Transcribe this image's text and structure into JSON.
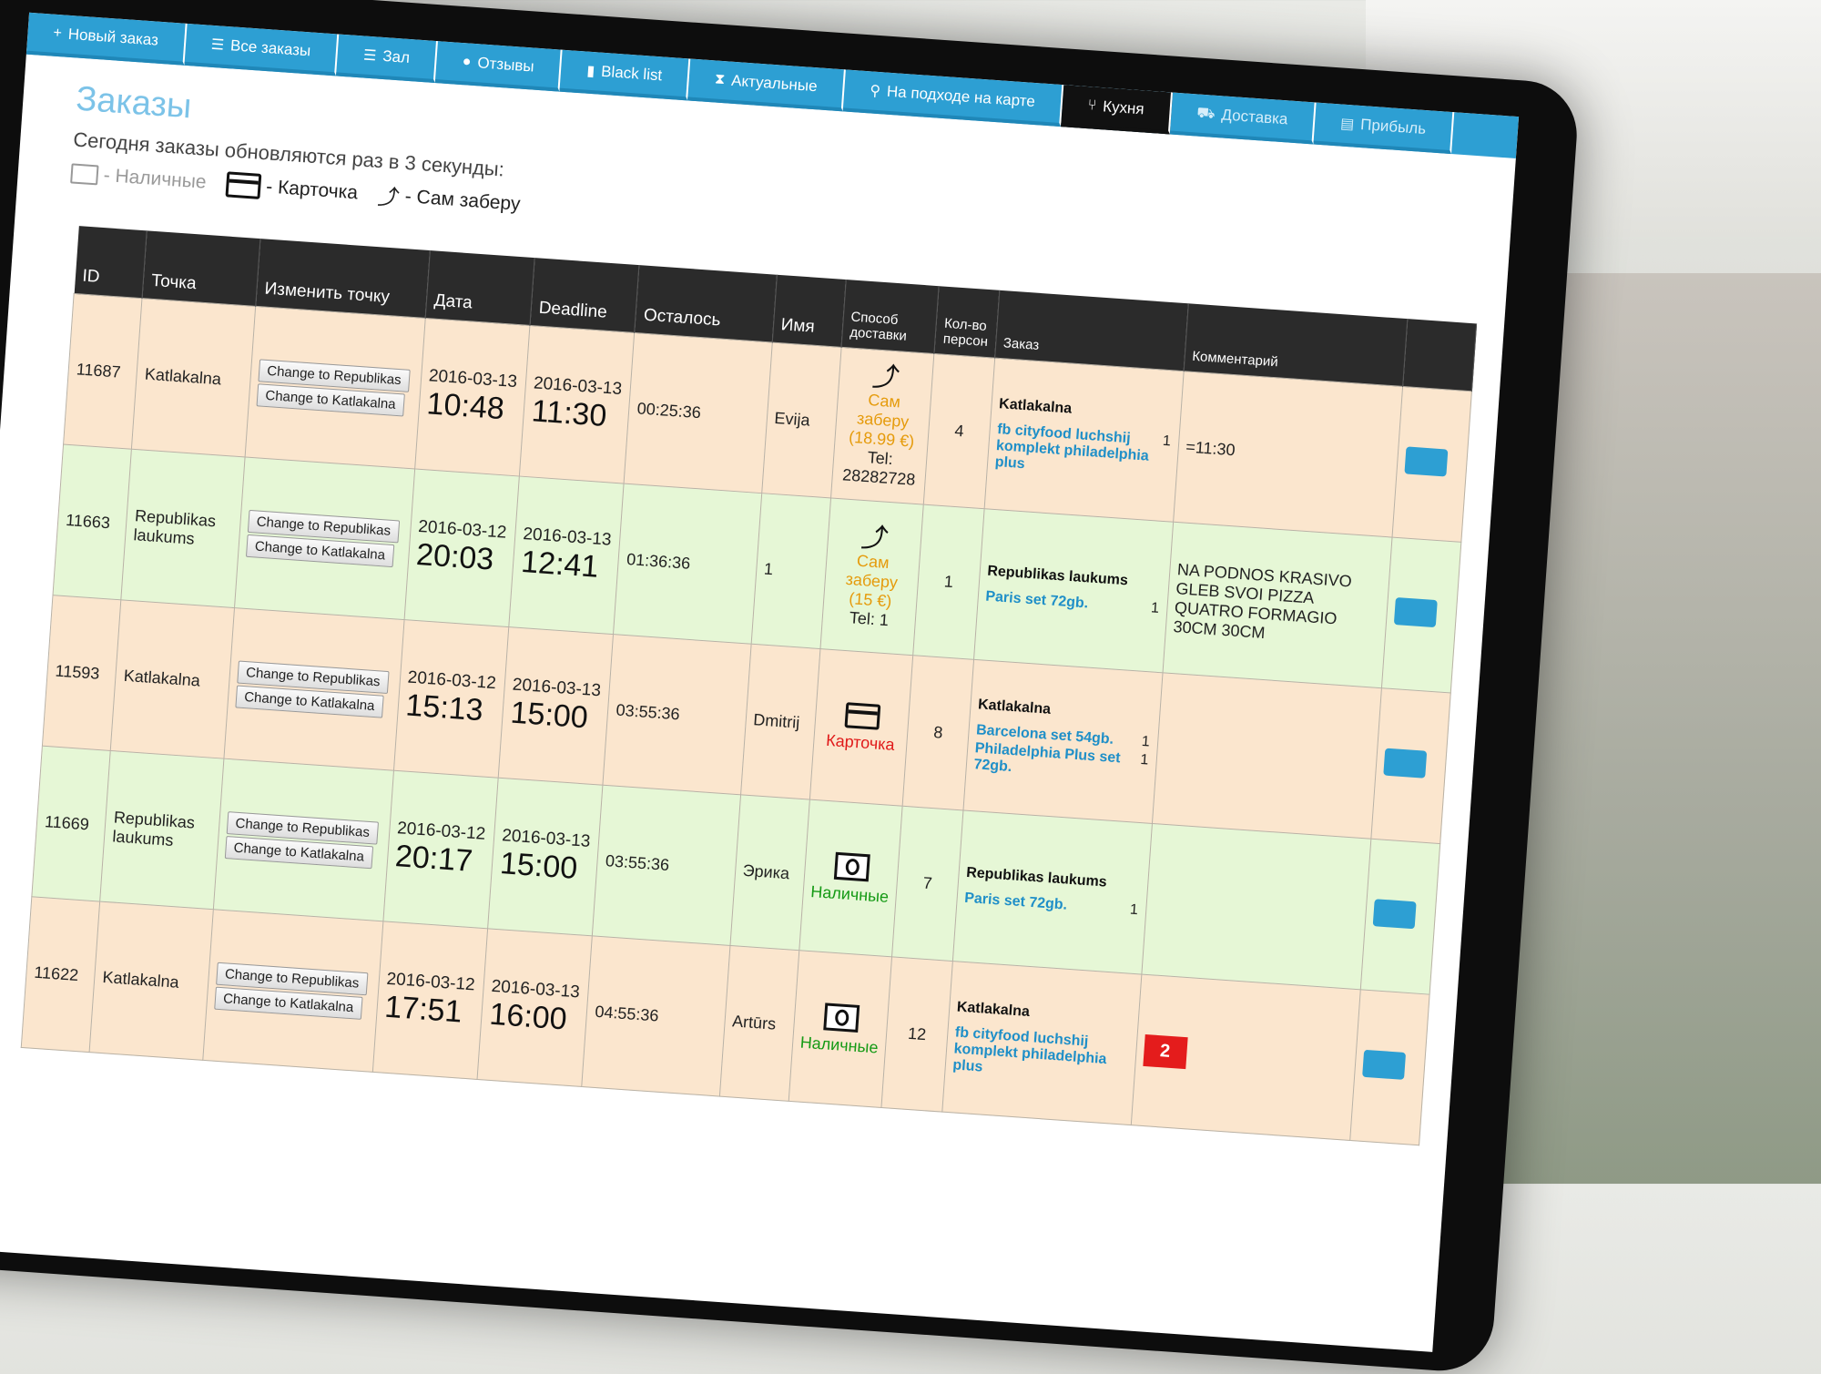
{
  "nav": {
    "tabs": [
      {
        "icon": "+",
        "label": "Новый заказ"
      },
      {
        "icon": "☰",
        "label": "Все заказы"
      },
      {
        "icon": "☰",
        "label": "Зал"
      },
      {
        "icon": "●",
        "label": "Отзывы"
      },
      {
        "icon": "▮",
        "label": "Black list"
      },
      {
        "icon": "⧗",
        "label": "Актуальные"
      },
      {
        "icon": "⚲",
        "label": "На подходе на карте"
      },
      {
        "icon": "⑂",
        "label": "Кухня"
      },
      {
        "icon": "⛟",
        "label": "Доставка"
      },
      {
        "icon": "▤",
        "label": "Прибыль"
      }
    ],
    "active_index": 7
  },
  "page": {
    "title": "Заказы",
    "info": "Сегодня заказы обновляются раз в 3 секунды:",
    "legend": {
      "cash": "- Наличные",
      "card": "- Карточка",
      "pickup": "- Сам заберу"
    }
  },
  "table": {
    "headers": {
      "id": "ID",
      "point": "Точка",
      "change": "Изменить точку",
      "date": "Дата",
      "deadline": "Deadline",
      "left": "Осталось",
      "name": "Имя",
      "delivery": "Способ доставки",
      "persons": "Кол-во персон",
      "order": "Заказ",
      "comment": "Комментарий"
    },
    "change_to_republikas": "Change to Republikas",
    "change_to_katlakalna": "Change to Katlakalna",
    "rows": [
      {
        "id": "11687",
        "point": "Katlakalna",
        "color": "orange",
        "date": "2016-03-13",
        "date_time": "10:48",
        "deadline": "2016-03-13",
        "deadline_time": "11:30",
        "left": "00:25:36",
        "name": "Evija",
        "delivery": {
          "icon": "pickup-icon",
          "label": "Сам заберу",
          "price": "(18.99 €)",
          "tel": "Tel: 28282728"
        },
        "persons": "4",
        "order_loc": "Katlakalna",
        "items": [
          {
            "name": "fb cityfood luchshij komplekt philadelphia plus",
            "qty": "1"
          }
        ],
        "comment": "=11:30",
        "badge": ""
      },
      {
        "id": "11663",
        "point": "Republikas laukums",
        "color": "green",
        "date": "2016-03-12",
        "date_time": "20:03",
        "deadline": "2016-03-13",
        "deadline_time": "12:41",
        "left": "01:36:36",
        "name": "1",
        "delivery": {
          "icon": "pickup-icon",
          "label": "Сам заберу",
          "price": "(15 €)",
          "tel": "Tel: 1"
        },
        "persons": "1",
        "order_loc": "Republikas laukums",
        "items": [
          {
            "name": "Paris set 72gb.",
            "qty": "1"
          }
        ],
        "comment": "NA PODNOS KRASIVO GLEB SVOI PIZZA QUATRO FORMAGIO 30CM 30CM",
        "badge": ""
      },
      {
        "id": "11593",
        "point": "Katlakalna",
        "color": "orange",
        "date": "2016-03-12",
        "date_time": "15:13",
        "deadline": "2016-03-13",
        "deadline_time": "15:00",
        "left": "03:55:36",
        "name": "Dmitrij",
        "delivery": {
          "icon": "card-icon",
          "label": "Карточка",
          "price": "",
          "tel": ""
        },
        "persons": "8",
        "order_loc": "Katlakalna",
        "items": [
          {
            "name": "Barcelona set 54gb.",
            "qty": "1"
          },
          {
            "name": "Philadelphia Plus set 72gb.",
            "qty": "1"
          }
        ],
        "comment": "",
        "badge": ""
      },
      {
        "id": "11669",
        "point": "Republikas laukums",
        "color": "green",
        "date": "2016-03-12",
        "date_time": "20:17",
        "deadline": "2016-03-13",
        "deadline_time": "15:00",
        "left": "03:55:36",
        "name": "Эрика",
        "delivery": {
          "icon": "cash-icon",
          "label": "Наличные",
          "price": "",
          "tel": ""
        },
        "persons": "7",
        "order_loc": "Republikas laukums",
        "items": [
          {
            "name": "Paris set 72gb.",
            "qty": "1"
          }
        ],
        "comment": "",
        "badge": ""
      },
      {
        "id": "11622",
        "point": "Katlakalna",
        "color": "orange",
        "date": "2016-03-12",
        "date_time": "17:51",
        "deadline": "2016-03-13",
        "deadline_time": "16:00",
        "left": "04:55:36",
        "name": "Artūrs",
        "delivery": {
          "icon": "cash-icon",
          "label": "Наличные",
          "price": "",
          "tel": ""
        },
        "persons": "12",
        "order_loc": "Katlakalna",
        "items": [
          {
            "name": "fb cityfood luchshij komplekt philadelphia plus",
            "qty": ""
          }
        ],
        "comment": "",
        "badge": "2"
      }
    ]
  },
  "colors": {
    "nav": "#2d9fd3",
    "nav_active": "#111111",
    "row_orange": "#fbe6ce",
    "row_green": "#e6f7d6",
    "countdown": "#1515d6",
    "item_link": "#1f8fc8",
    "pickup": "#e59b0c",
    "card": "#e01919",
    "cash": "#159a15",
    "badge": "#e41c1c"
  }
}
